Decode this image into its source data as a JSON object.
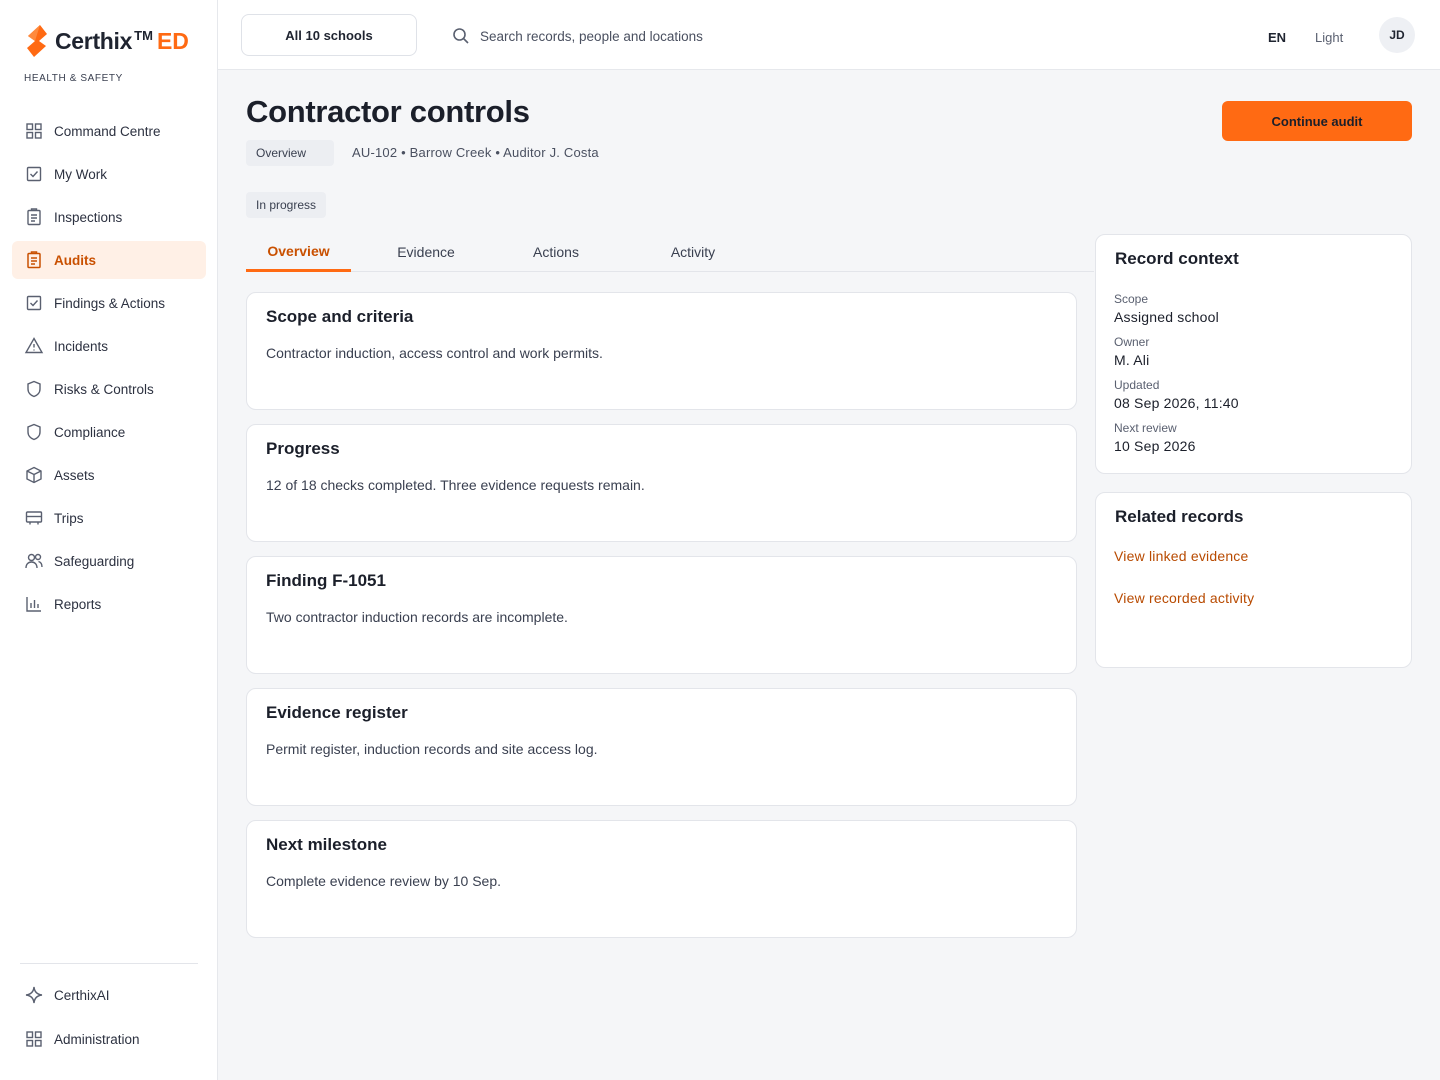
{
  "brand": {
    "name": "Certhix",
    "tm": "TM",
    "suffix": "ED",
    "subtitle": "HEALTH & SAFETY",
    "accent": "#ff6a13"
  },
  "sidebar": {
    "items": [
      {
        "label": "Command Centre",
        "icon": "grid-icon"
      },
      {
        "label": "My Work",
        "icon": "checkbox-icon"
      },
      {
        "label": "Inspections",
        "icon": "clipboard-icon"
      },
      {
        "label": "Audits",
        "icon": "clipboard-icon",
        "active": true
      },
      {
        "label": "Findings & Actions",
        "icon": "checkbox-icon"
      },
      {
        "label": "Incidents",
        "icon": "warning-icon"
      },
      {
        "label": "Risks & Controls",
        "icon": "shield-icon"
      },
      {
        "label": "Compliance",
        "icon": "shield-icon"
      },
      {
        "label": "Assets",
        "icon": "cube-icon"
      },
      {
        "label": "Trips",
        "icon": "bus-icon"
      },
      {
        "label": "Safeguarding",
        "icon": "people-icon"
      },
      {
        "label": "Reports",
        "icon": "bar-chart-icon"
      }
    ],
    "bottom": [
      {
        "label": "CerthixAI",
        "icon": "sparkle-icon"
      },
      {
        "label": "Administration",
        "icon": "grid-icon"
      }
    ]
  },
  "topbar": {
    "school_select": "All 10 schools",
    "search_placeholder": "Search records, people and locations",
    "language": "EN",
    "theme": "Light",
    "avatar_initials": "JD"
  },
  "page": {
    "title": "Contractor controls",
    "breadcrumb": "Overview",
    "meta": "AU-102 • Barrow Creek • Auditor J. Costa",
    "status": "In progress",
    "primary_action": "Continue audit"
  },
  "tabs": [
    "Overview",
    "Evidence",
    "Actions",
    "Activity"
  ],
  "cards": [
    {
      "title": "Scope and criteria",
      "body": "Contractor induction, access control and work permits."
    },
    {
      "title": "Progress",
      "body": "12 of 18 checks completed. Three evidence requests remain."
    },
    {
      "title": "Finding F-1051",
      "body": "Two contractor induction records are incomplete."
    },
    {
      "title": "Evidence register",
      "body": "Permit register, induction records and site access log."
    },
    {
      "title": "Next milestone",
      "body": "Complete evidence review by 10 Sep."
    }
  ],
  "record_context": {
    "title": "Record context",
    "fields": [
      {
        "label": "Scope",
        "value": "Assigned school"
      },
      {
        "label": "Owner",
        "value": "M. Ali"
      },
      {
        "label": "Updated",
        "value": "08 Sep 2026, 11:40"
      },
      {
        "label": "Next review",
        "value": "10 Sep 2026"
      }
    ]
  },
  "related_records": {
    "title": "Related records",
    "links": [
      "View linked evidence",
      "View recorded activity"
    ]
  }
}
